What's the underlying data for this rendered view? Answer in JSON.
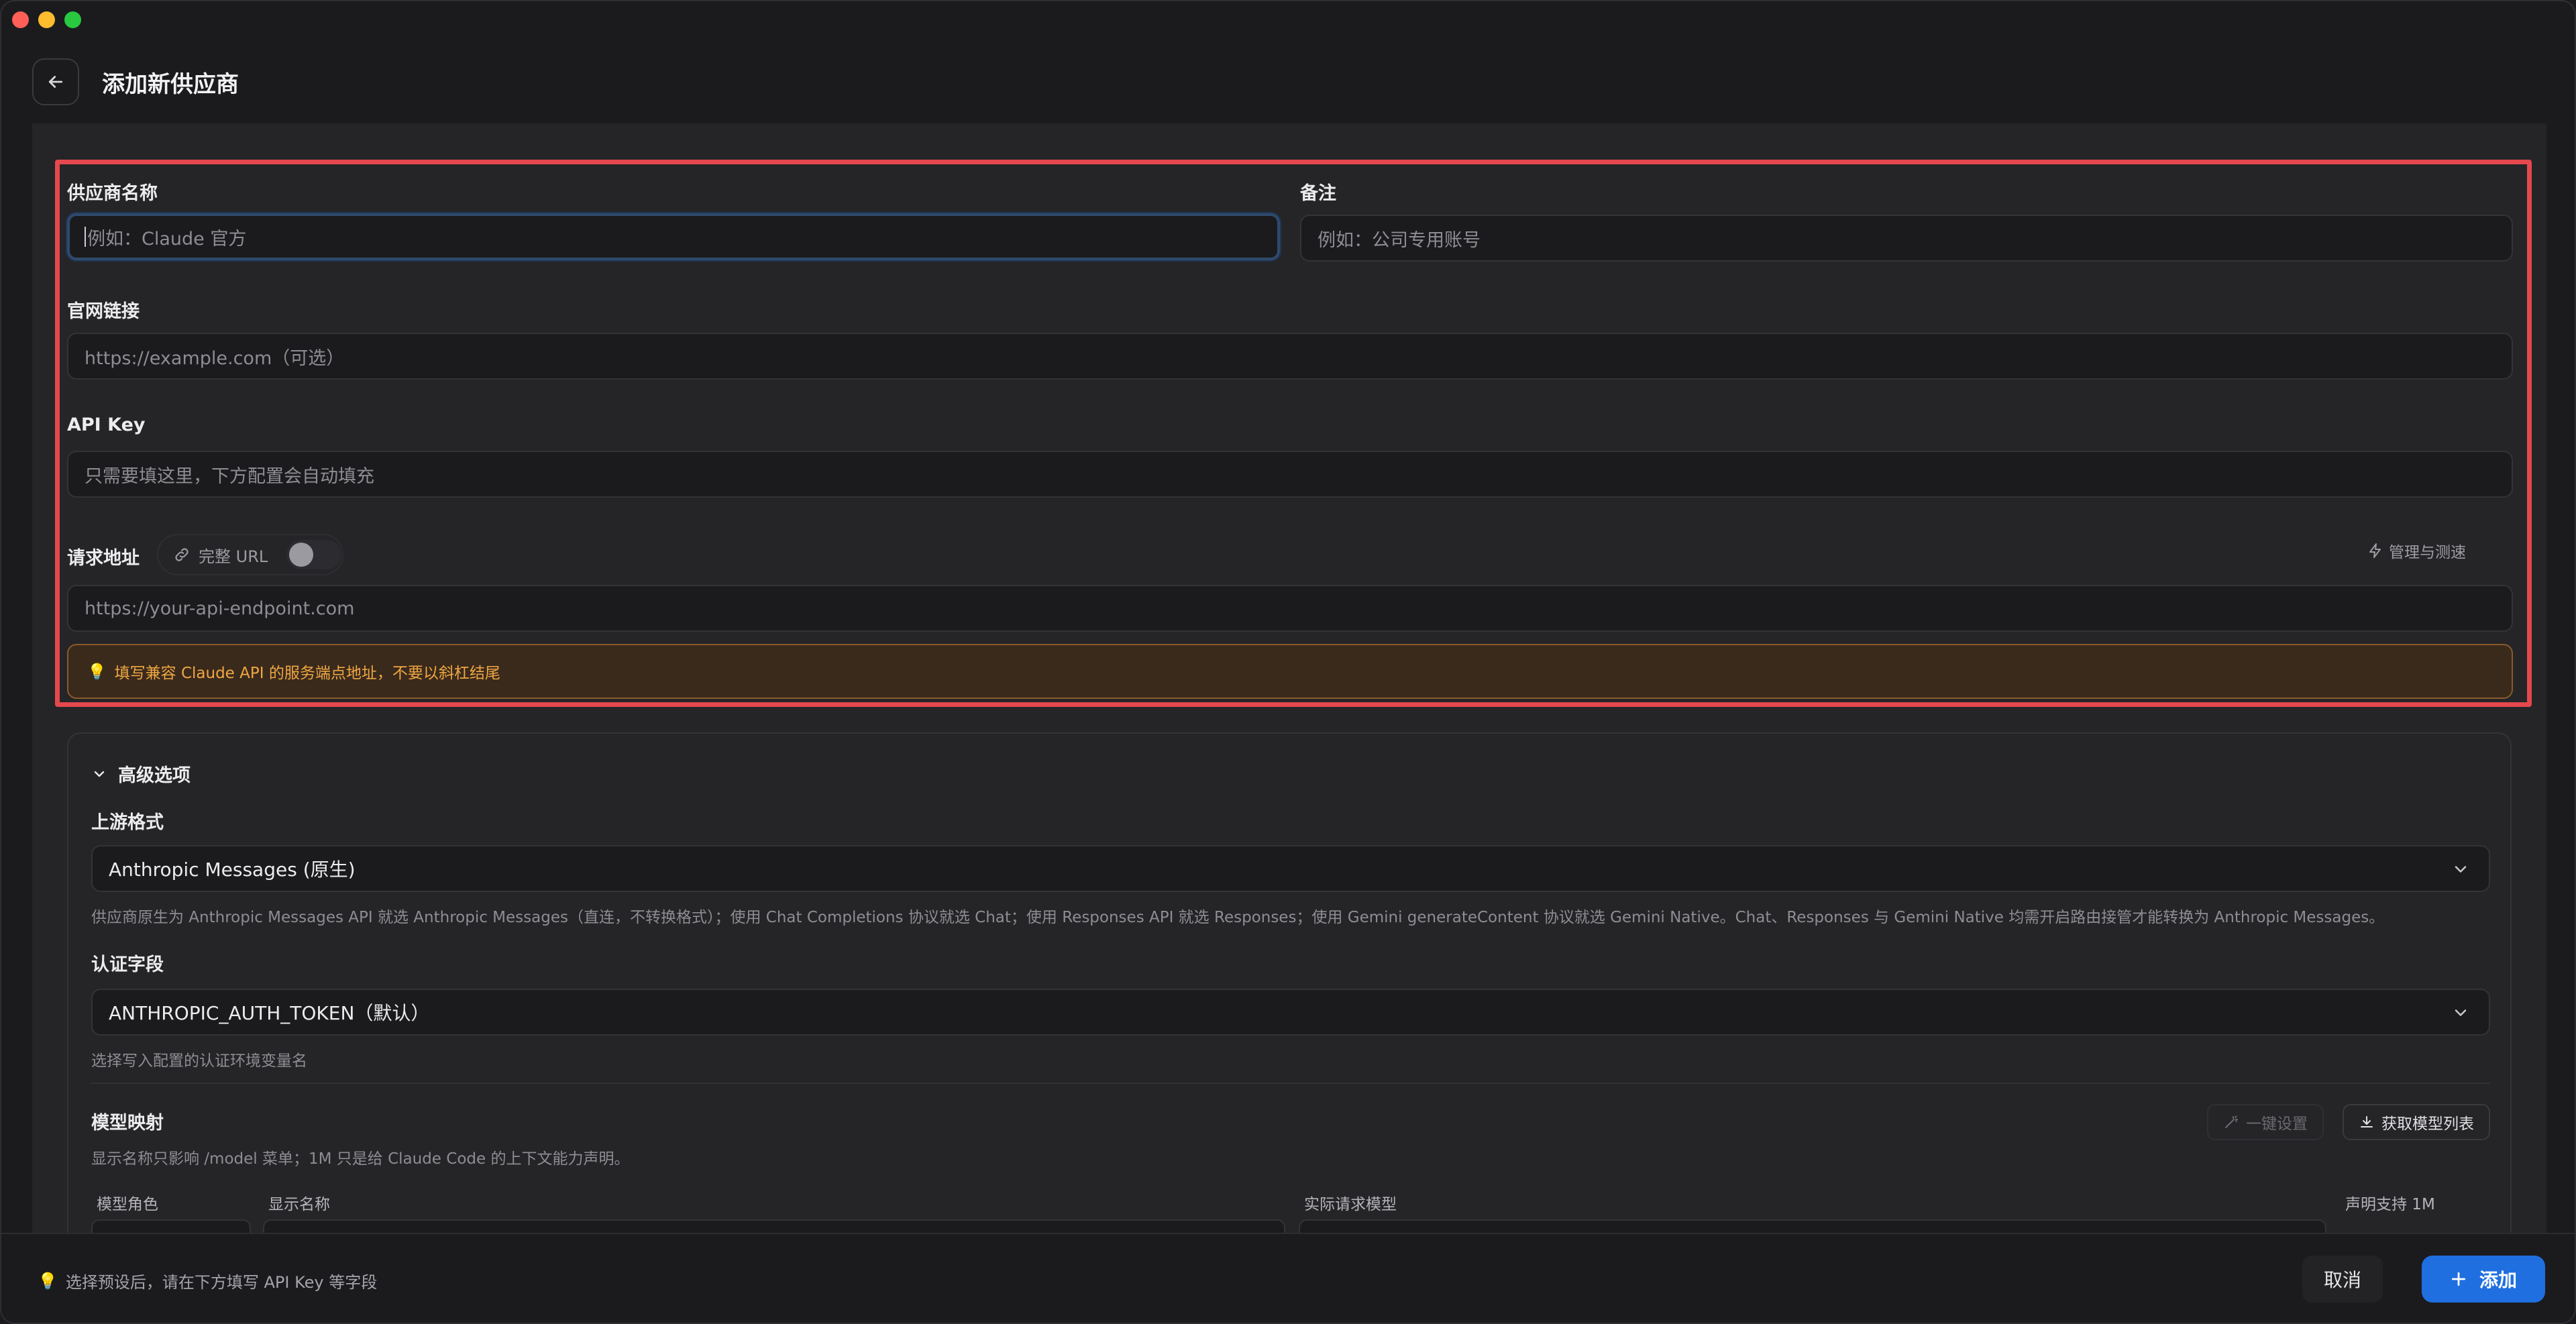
{
  "header": {
    "title": "添加新供应商"
  },
  "form": {
    "provider_name": {
      "label": "供应商名称",
      "placeholder": "例如：Claude 官方"
    },
    "notes": {
      "label": "备注",
      "placeholder": "例如：公司专用账号"
    },
    "website": {
      "label": "官网链接",
      "placeholder": "https://example.com（可选）"
    },
    "api_key": {
      "label": "API Key",
      "placeholder": "只需要填这里，下方配置会自动填充"
    },
    "endpoint": {
      "label": "请求地址",
      "toggle_label": "完整 URL",
      "toggle_on": false,
      "manage_label": "管理与测速",
      "placeholder": "https://your-api-endpoint.com",
      "tip": "填写兼容 Claude API 的服务端点地址，不要以斜杠结尾"
    }
  },
  "advanced": {
    "title": "高级选项",
    "upstream_format": {
      "label": "上游格式",
      "value": "Anthropic Messages (原生)",
      "help": "供应商原生为 Anthropic Messages API 就选 Anthropic Messages（直连，不转换格式）；使用 Chat Completions 协议就选 Chat；使用 Responses API 就选 Responses；使用 Gemini generateContent 协议就选 Gemini Native。Chat、Responses 与 Gemini Native 均需开启路由接管才能转换为 Anthropic Messages。"
    },
    "auth_field": {
      "label": "认证字段",
      "value": "ANTHROPIC_AUTH_TOKEN（默认）",
      "help": "选择写入配置的认证环境变量名"
    },
    "model_mapping": {
      "label": "模型映射",
      "help": "显示名称只影响 /model 菜单；1M 只是给 Claude Code 的上下文能力声明。",
      "one_click_label": "一键设置",
      "fetch_label": "获取模型列表",
      "columns": [
        "模型角色",
        "显示名称",
        "实际请求模型",
        "声明支持 1M"
      ]
    }
  },
  "footer": {
    "tip": "选择预设后，请在下方填写 API Key 等字段",
    "cancel_label": "取消",
    "add_label": "添加"
  }
}
